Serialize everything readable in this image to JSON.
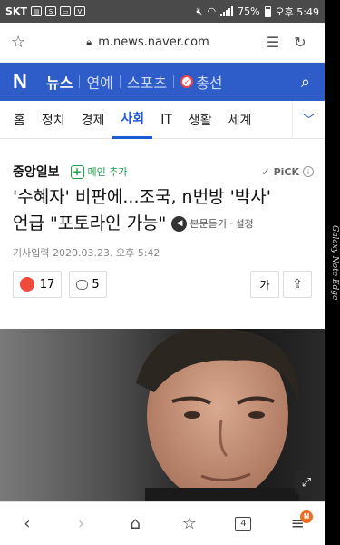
{
  "status_bar": {
    "carrier": "SKT",
    "battery": "75%",
    "time": "오후 5:49"
  },
  "url_bar": {
    "url": "m.news.naver.com"
  },
  "naver_header": {
    "logo": "N",
    "tabs": [
      "뉴스",
      "연예",
      "스포츠",
      "총선"
    ],
    "active_tab": "뉴스"
  },
  "section_tabs": {
    "items": [
      "홈",
      "정치",
      "경제",
      "사회",
      "IT",
      "생활",
      "세계"
    ],
    "active": "사회"
  },
  "article": {
    "press": "중앙일보",
    "add_main_label": "메인 추가",
    "pick_label": "PiCK",
    "headline_line1": "'수혜자' 비판에...조국, n번방 '박사'",
    "headline_line2": "언급 \"포토라인 가능\"",
    "listen_label": "본문듣기",
    "settings_label": "설정",
    "date_label": "기사입력",
    "date_value": "2020.03.23. 오후 5:42",
    "reaction_count": "17",
    "comment_count": "5",
    "font_button_label": "가"
  },
  "bottom_nav": {
    "tab_count": "4",
    "menu_badge": "N"
  },
  "device": {
    "edge_text": "Galaxy Note Edge"
  },
  "colors": {
    "naver_blue": "#2e5dc9",
    "active_section": "#1f5bd6",
    "add_green": "#1c9f4a",
    "reaction_red": "#f04a3d",
    "badge_orange": "#f26d21"
  }
}
